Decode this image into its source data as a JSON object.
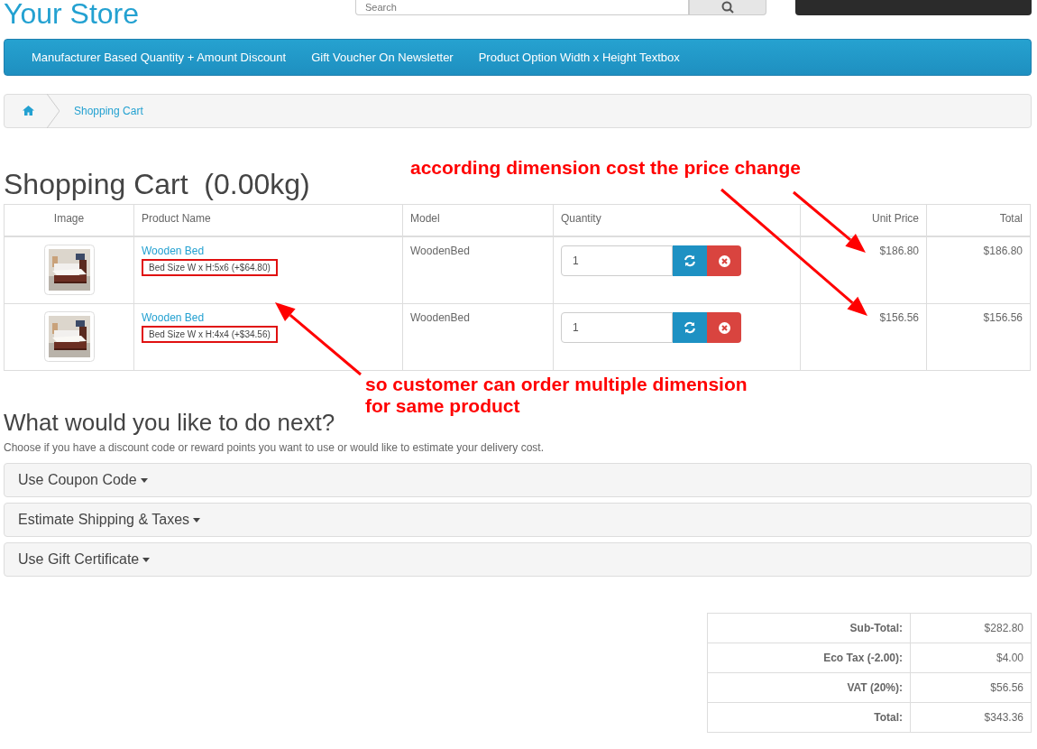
{
  "store_name": "Your Store",
  "search": {
    "placeholder": "Search"
  },
  "nav": [
    "Manufacturer Based Quantity + Amount Discount",
    "Gift Voucher On Newsletter",
    "Product Option Width x Height Textbox"
  ],
  "breadcrumb": [
    {
      "kind": "home"
    },
    {
      "kind": "link",
      "label": "Shopping Cart"
    }
  ],
  "heading": "Shopping Cart  (0.00kg)",
  "cart": {
    "columns": [
      "Image",
      "Product Name",
      "Model",
      "Quantity",
      "Unit Price",
      "Total"
    ],
    "rows": [
      {
        "name": "Wooden Bed",
        "option": "Bed Size W x H:5x6 (+$64.80)",
        "option_highlighted": true,
        "model": "WoodenBed",
        "quantity": "1",
        "unit_price": "$186.80",
        "total": "$186.80"
      },
      {
        "name": "Wooden Bed",
        "option": "Bed Size W x H:4x4 (+$34.56)",
        "option_highlighted": true,
        "model": "WoodenBed",
        "quantity": "1",
        "unit_price": "$156.56",
        "total": "$156.56"
      }
    ]
  },
  "next": {
    "title": "What would you like to do next?",
    "description": "Choose if you have a discount code or reward points you want to use or would like to estimate your delivery cost.",
    "panels": [
      "Use Coupon Code",
      "Estimate Shipping & Taxes",
      "Use Gift Certificate"
    ]
  },
  "totals": [
    {
      "label": "Sub-Total:",
      "value": "$282.80"
    },
    {
      "label": "Eco Tax (-2.00):",
      "value": "$4.00"
    },
    {
      "label": "VAT (20%):",
      "value": "$56.56"
    },
    {
      "label": "Total:",
      "value": "$343.36"
    }
  ],
  "annotations": [
    {
      "lines": [
        "according dimension cost the price change"
      ]
    },
    {
      "lines": [
        "so customer can order multiple dimension",
        "for same product"
      ]
    }
  ]
}
